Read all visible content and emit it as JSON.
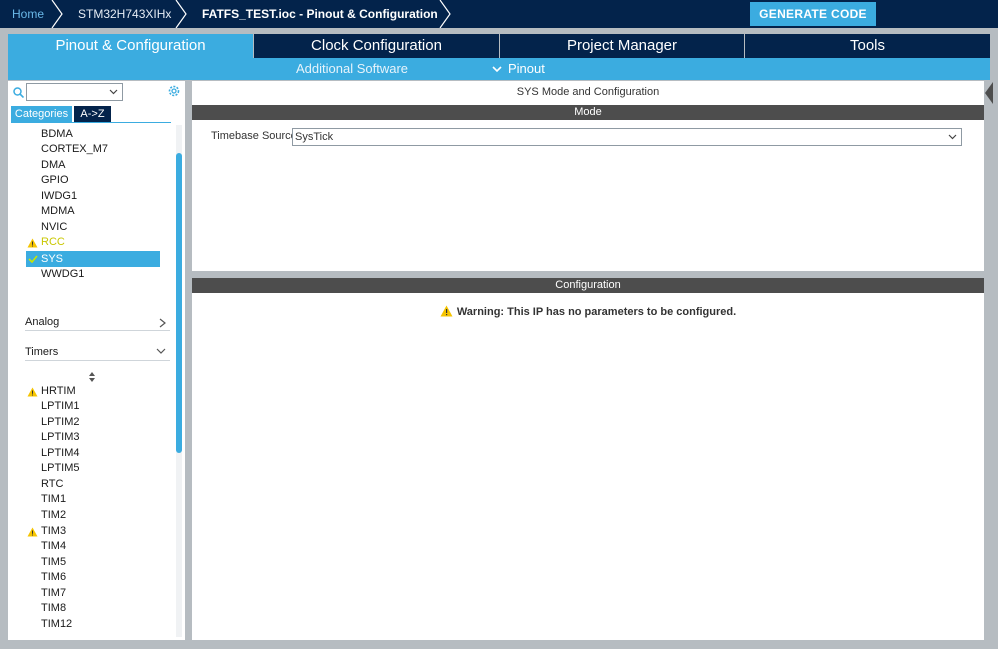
{
  "breadcrumb": {
    "home": "Home",
    "chip": "STM32H743XIHx",
    "file": "FATFS_TEST.ioc - Pinout & Configuration"
  },
  "generate_button": "GENERATE CODE",
  "tabs": {
    "pinout": "Pinout & Configuration",
    "clock": "Clock Configuration",
    "project": "Project Manager",
    "tools": "Tools"
  },
  "subtabs": {
    "additional": "Additional Software",
    "pinout": "Pinout"
  },
  "left": {
    "category_tab": "Categories",
    "az_tab": "A->Z",
    "system_core_items": [
      "BDMA",
      "CORTEX_M7",
      "DMA",
      "GPIO",
      "IWDG1",
      "MDMA",
      "NVIC",
      "RCC",
      "SYS",
      "WWDG1"
    ],
    "groups": {
      "analog": "Analog",
      "timers": "Timers"
    },
    "timer_items": [
      "HRTIM",
      "LPTIM1",
      "LPTIM2",
      "LPTIM3",
      "LPTIM4",
      "LPTIM5",
      "RTC",
      "TIM1",
      "TIM2",
      "TIM3",
      "TIM4",
      "TIM5",
      "TIM6",
      "TIM7",
      "TIM8",
      "TIM12"
    ]
  },
  "mode_panel": {
    "title": "SYS Mode and Configuration",
    "mode_header": "Mode",
    "timebase_label": "Timebase Source",
    "timebase_value": "SysTick"
  },
  "config_panel": {
    "header": "Configuration",
    "warning": "Warning: This IP has no parameters to be configured."
  },
  "colors": {
    "navy": "#03234b",
    "accent": "#3bace0",
    "warning": "#f5c400"
  }
}
